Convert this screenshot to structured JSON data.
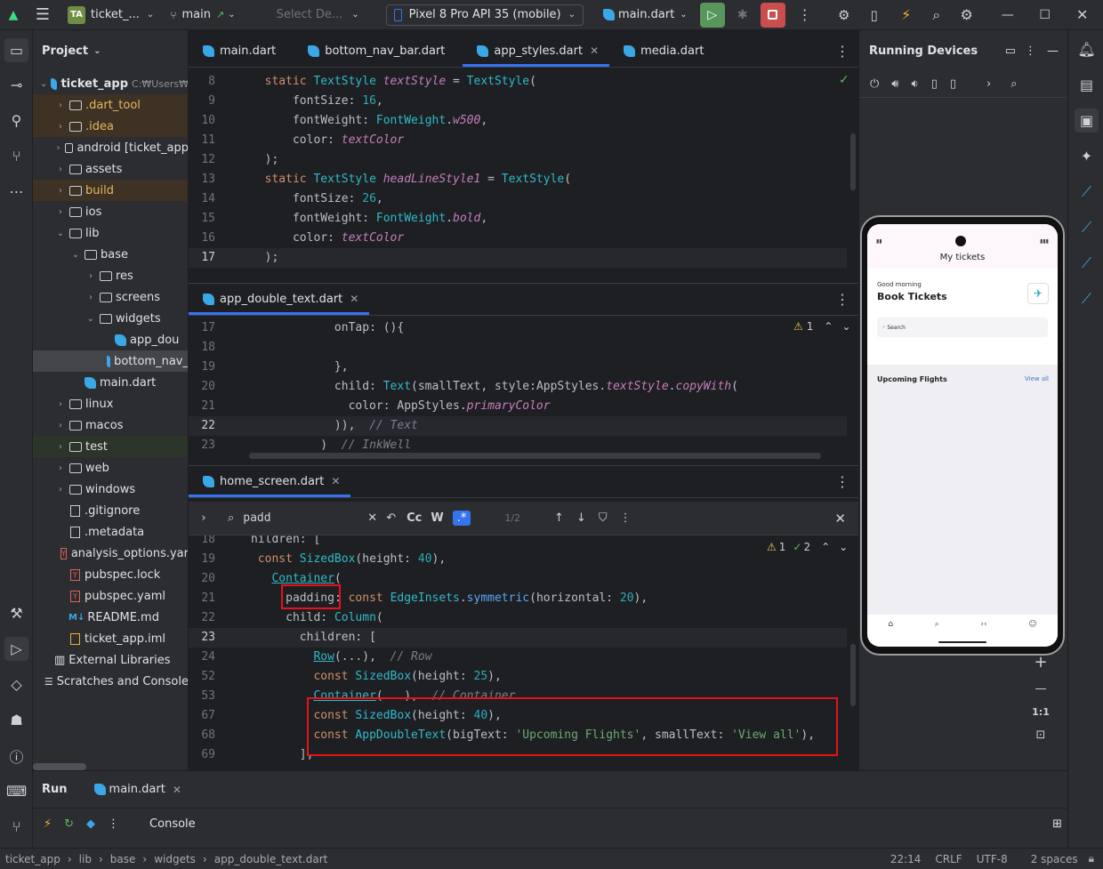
{
  "titlebar": {
    "project_badge": "TA",
    "project_name": "ticket_...",
    "branch": "main",
    "select_device": "Select De...",
    "device": "Pixel 8 Pro API 35 (mobile)",
    "run_config": "main.dart"
  },
  "project_panel": {
    "title": "Project",
    "tree": [
      {
        "label": "ticket_app",
        "suffix": "C:₩Users₩",
        "type": "root",
        "expanded": true
      },
      {
        "label": ".dart_tool",
        "type": "folder",
        "expanded": false,
        "highlight": "orange"
      },
      {
        "label": ".idea",
        "type": "folder",
        "expanded": false,
        "highlight": "orange"
      },
      {
        "label": "android [ticket_app",
        "type": "folder",
        "expanded": false
      },
      {
        "label": "assets",
        "type": "folder",
        "expanded": false
      },
      {
        "label": "build",
        "type": "folder",
        "expanded": false,
        "highlight": "orange"
      },
      {
        "label": "ios",
        "type": "folder",
        "expanded": false
      },
      {
        "label": "lib",
        "type": "folder",
        "expanded": true
      },
      {
        "label": "base",
        "type": "folder",
        "expanded": true
      },
      {
        "label": "res",
        "type": "folder",
        "expanded": false
      },
      {
        "label": "screens",
        "type": "folder",
        "expanded": false
      },
      {
        "label": "widgets",
        "type": "folder",
        "expanded": true
      },
      {
        "label": "app_dou",
        "type": "dart"
      },
      {
        "label": "bottom_nav_",
        "type": "dart",
        "selected": true
      },
      {
        "label": "main.dart",
        "type": "dart"
      },
      {
        "label": "linux",
        "type": "folder",
        "expanded": false
      },
      {
        "label": "macos",
        "type": "folder",
        "expanded": false
      },
      {
        "label": "test",
        "type": "folder",
        "expanded": false,
        "highlight": "green"
      },
      {
        "label": "web",
        "type": "folder",
        "expanded": false
      },
      {
        "label": "windows",
        "type": "folder",
        "expanded": false
      },
      {
        "label": ".gitignore",
        "type": "file"
      },
      {
        "label": ".metadata",
        "type": "file"
      },
      {
        "label": "analysis_options.yar",
        "type": "yaml"
      },
      {
        "label": "pubspec.lock",
        "type": "yaml"
      },
      {
        "label": "pubspec.yaml",
        "type": "yaml"
      },
      {
        "label": "README.md",
        "type": "md"
      },
      {
        "label": "ticket_app.iml",
        "type": "iml"
      },
      {
        "label": "External Libraries",
        "type": "lib"
      },
      {
        "label": "Scratches and Console",
        "type": "scratch"
      }
    ]
  },
  "editor1": {
    "tabs": [
      "main.dart",
      "bottom_nav_bar.dart",
      "app_styles.dart",
      "media.dart"
    ],
    "active_tab": "app_styles.dart",
    "lines": [
      {
        "n": "8",
        "code": "  static TextStyle textStyle = TextStyle("
      },
      {
        "n": "9",
        "code": "      fontSize: 16,"
      },
      {
        "n": "10",
        "code": "      fontWeight: FontWeight.w500,"
      },
      {
        "n": "11",
        "code": "      color: textColor"
      },
      {
        "n": "12",
        "code": "  );"
      },
      {
        "n": "13",
        "code": "  static TextStyle headLineStyle1 = TextStyle("
      },
      {
        "n": "14",
        "code": "      fontSize: 26,"
      },
      {
        "n": "15",
        "code": "      fontWeight: FontWeight.bold,"
      },
      {
        "n": "16",
        "code": "      color: textColor"
      },
      {
        "n": "17",
        "code": "  );"
      }
    ]
  },
  "editor2": {
    "tab": "app_double_text.dart",
    "warning_count": "1",
    "lines": [
      {
        "n": "17",
        "code": "            onTap: (){"
      },
      {
        "n": "18",
        "code": ""
      },
      {
        "n": "19",
        "code": "            },"
      },
      {
        "n": "20",
        "code": "            child: Text(smallText, style:AppStyles.textStyle.copyWith("
      },
      {
        "n": "21",
        "code": "              color: AppStyles.primaryColor"
      },
      {
        "n": "22",
        "code": "            )),  // Text"
      },
      {
        "n": "23",
        "code": "          )  // InkWell"
      }
    ]
  },
  "editor3": {
    "tab": "home_screen.dart",
    "search": {
      "query": "padd",
      "match_case": "Cc",
      "words": "W",
      "regex": ".*",
      "count": "1/2"
    },
    "warning_count": "1",
    "check_count": "2",
    "lines": [
      {
        "n": "18",
        "code": "hildren: ["
      },
      {
        "n": "19",
        "code": " const SizedBox(height: 40),"
      },
      {
        "n": "20",
        "code": "   Container("
      },
      {
        "n": "21",
        "code": "     padding: const EdgeInsets.symmetric(horizontal: 20),"
      },
      {
        "n": "22",
        "code": "     child: Column("
      },
      {
        "n": "23",
        "code": "       children: ["
      },
      {
        "n": "24",
        "code": "         Row(...),  // Row"
      },
      {
        "n": "52",
        "code": "         const SizedBox(height: 25),"
      },
      {
        "n": "53",
        "code": "         Container(...),  // Container"
      },
      {
        "n": "67",
        "code": "         const SizedBox(height: 40),"
      },
      {
        "n": "68",
        "code": "         const AppDoubleText(bigText: 'Upcoming Flights', smallText: 'View all'),"
      },
      {
        "n": "69",
        "code": "       ],"
      }
    ]
  },
  "devices": {
    "title": "Running Devices",
    "zoom_label": "1:1"
  },
  "phone": {
    "app_bar_title": "My tickets",
    "greeting": "Good morning",
    "headline": "Book Tickets",
    "search_placeholder": "Search",
    "section_title": "Upcoming Flights",
    "section_link": "View all"
  },
  "run": {
    "tab_run": "Run",
    "tab_file": "main.dart",
    "console": "Console"
  },
  "statusbar": {
    "breadcrumb": [
      "ticket_app",
      "lib",
      "base",
      "widgets",
      "app_double_text.dart"
    ],
    "position": "22:14",
    "line_sep": "CRLF",
    "encoding": "UTF-8",
    "indent": "2 spaces"
  }
}
